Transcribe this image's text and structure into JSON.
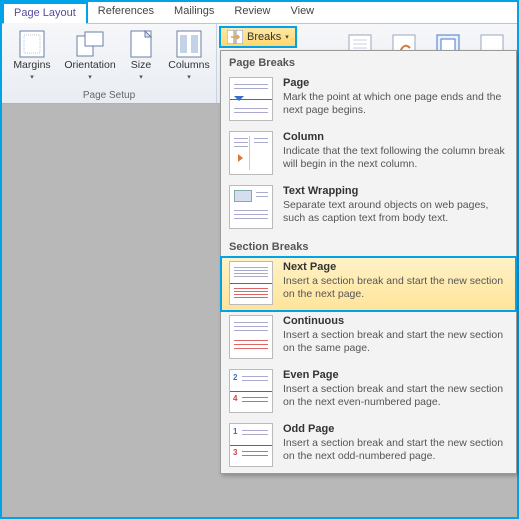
{
  "tabs": {
    "page_layout": "Page Layout",
    "references": "References",
    "mailings": "Mailings",
    "review": "Review",
    "view": "View"
  },
  "page_setup": {
    "margins": "Margins",
    "orientation": "Orientation",
    "size": "Size",
    "columns": "Columns",
    "group_label": "Page Setup"
  },
  "breaks_label": "Breaks",
  "dropdown": {
    "page_breaks_header": "Page Breaks",
    "section_breaks_header": "Section Breaks",
    "page": {
      "title": "Page",
      "desc": "Mark the point at which one page ends and the next page begins."
    },
    "column": {
      "title": "Column",
      "desc": "Indicate that the text following the column break will begin in the next column."
    },
    "text_wrapping": {
      "title": "Text Wrapping",
      "desc": "Separate text around objects on web pages, such as caption text from body text."
    },
    "next_page": {
      "title": "Next Page",
      "desc": "Insert a section break and start the new section on the next page."
    },
    "continuous": {
      "title": "Continuous",
      "desc": "Insert a section break and start the new section on the same page."
    },
    "even_page": {
      "title": "Even Page",
      "desc": "Insert a section break and start the new section on the next even-numbered page."
    },
    "odd_page": {
      "title": "Odd Page",
      "desc": "Insert a section break and start the new section on the next odd-numbered page."
    }
  }
}
